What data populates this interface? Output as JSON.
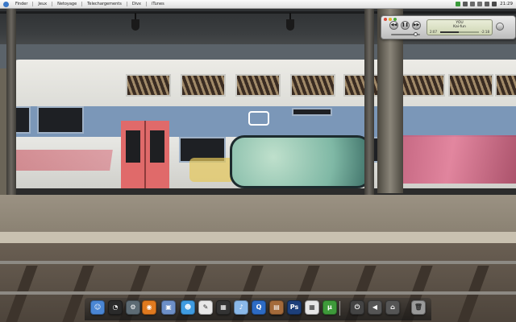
{
  "menubar": {
    "items": [
      {
        "label": "Finder",
        "icon": "finder-icon"
      },
      {
        "label": "Jeux",
        "icon": "games-icon"
      },
      {
        "label": "Netoyage",
        "icon": "cleanup-icon"
      },
      {
        "label": "Telechargements",
        "icon": "downloads-icon"
      },
      {
        "label": "Divx",
        "icon": "divx-icon"
      },
      {
        "label": "iTunes",
        "icon": "itunes-icon"
      }
    ],
    "clock": "21:29"
  },
  "mini_player": {
    "title": "YOU",
    "artist": "Kai-fun",
    "elapsed": "2:07",
    "remaining": "-2:18",
    "progress_fraction": 0.48,
    "volume_fraction": 0.8
  },
  "dock": {
    "items": [
      {
        "name": "finder-icon",
        "color": "#4a86d4"
      },
      {
        "name": "dashboard-icon",
        "color": "#2a2a2a"
      },
      {
        "name": "system-preferences-icon",
        "color": "#5d6b74"
      },
      {
        "name": "firefox-icon",
        "color": "#e07a1f"
      },
      {
        "name": "preview-icon",
        "color": "#6d8fc7"
      },
      {
        "name": "ichat-icon",
        "color": "#3f9be0"
      },
      {
        "name": "textedit-icon",
        "color": "#e8e8e8"
      },
      {
        "name": "clapperboard-icon",
        "color": "#333333"
      },
      {
        "name": "itunes-icon",
        "color": "#8ab8e8"
      },
      {
        "name": "quicktime-icon",
        "color": "#2d6bc4"
      },
      {
        "name": "media-player-icon",
        "color": "#1e3c8a"
      },
      {
        "name": "photo-icon",
        "color": "#a46a3a"
      },
      {
        "name": "photoshop-icon",
        "color": "#1d3f7a"
      },
      {
        "name": "calendar-icon",
        "color": "#e6e6e6"
      },
      {
        "name": "utorrent-icon",
        "color": "#3e9a3a"
      },
      {
        "name": "shutdown-icon",
        "color": "#444444"
      },
      {
        "name": "back-icon",
        "color": "#555555"
      },
      {
        "name": "home-icon",
        "color": "#555555"
      },
      {
        "name": "trash-icon",
        "color": "#9a9a9a"
      }
    ]
  },
  "colors": {
    "menubar": "#f2f2f2",
    "train_stripe": "#7b97b8",
    "door": "#e06a6a"
  }
}
